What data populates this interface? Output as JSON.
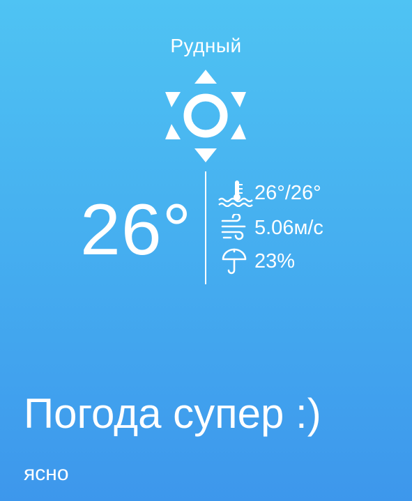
{
  "city": "Рудный",
  "weather_icon": "sun-icon",
  "temperature": "26°",
  "feels_like": {
    "icon": "thermometer-water-icon",
    "value": "26°/26°"
  },
  "wind": {
    "icon": "wind-icon",
    "value": "5.06м/с"
  },
  "precipitation": {
    "icon": "umbrella-icon",
    "value": "23%"
  },
  "headline": "Погода супер :)",
  "description": "ясно",
  "colors": {
    "gradient_top": "#4fc3f3",
    "gradient_bottom": "#3d97ec",
    "text": "#ffffff"
  }
}
